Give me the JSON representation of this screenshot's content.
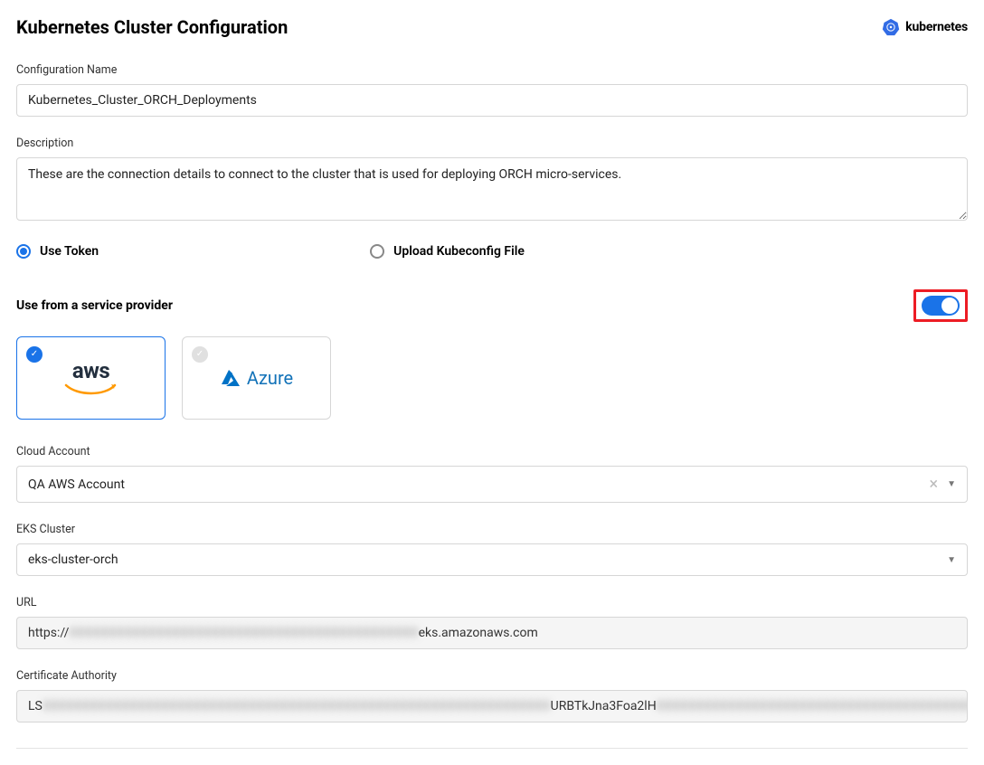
{
  "header": {
    "title": "Kubernetes Cluster Configuration",
    "brand": "kubernetes"
  },
  "fields": {
    "config_name_label": "Configuration Name",
    "config_name_value": "Kubernetes_Cluster_ORCH_Deployments",
    "description_label": "Description",
    "description_value": "These are the connection details to connect to the cluster that is used for deploying ORCH micro-services.",
    "radio_use_token": "Use Token",
    "radio_upload_kubeconfig": "Upload Kubeconfig File",
    "provider_label": "Use from a service provider",
    "provider_aws": "aws",
    "provider_azure": "Azure",
    "cloud_account_label": "Cloud Account",
    "cloud_account_value": "QA AWS Account",
    "eks_cluster_label": "EKS Cluster",
    "eks_cluster_value": "eks-cluster-orch",
    "url_label": "URL",
    "url_value_prefix": "https://",
    "url_value_blur": "XXXXXXXXXXXXXXXXXXXXXXXXXXXXXXXXXXXXXXXXXXXX",
    "url_value_suffix": "eks.amazonaws.com",
    "cert_label": "Certificate Authority",
    "cert_prefix": "LS",
    "cert_blur1": "XXXXXXXXXXXXXXXXXXXXXXXXXXXXXXXXXXXXXXXXXXXXXXXXXXXXXXXXXXXXXXXX",
    "cert_mid": "URBTkJna3Foa2lH",
    "cert_blur2": "XXXXXXXXXXXXXXXXXXXXXXXXXXXXXXXXXXXXXXXXXXXXXXXXXXXXXXXX",
    "cert_suffix": "GRHVi"
  }
}
